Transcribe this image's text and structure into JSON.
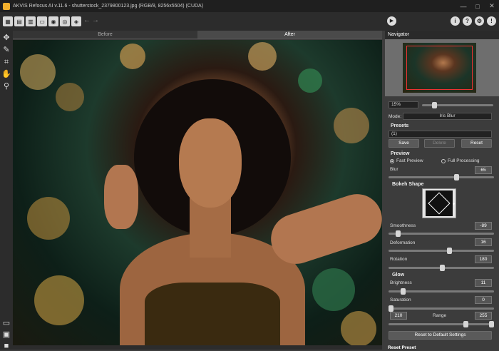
{
  "window": {
    "title": "AKVIS Refocus AI v.11.6 - shutterstock_2379800123.jpg (RGB/8, 8256x5504) (CUDA)",
    "minimize": "—",
    "maximize": "□",
    "close": "✕"
  },
  "toolbar": {
    "icons": [
      "workspace-icon",
      "open-icon",
      "save-icon",
      "print-icon",
      "share-icon",
      "batch-icon",
      "plugins-icon"
    ],
    "undo": "←",
    "redo": "→",
    "run": "▶",
    "help_about": "i",
    "help": "?",
    "settings": "⚙",
    "feedback": "!"
  },
  "tabs": {
    "before": "Before",
    "after": "After"
  },
  "tools": [
    "move-icon",
    "retouch-icon",
    "crop-icon",
    "hand-icon",
    "zoom-icon"
  ],
  "navigator": {
    "title": "Navigator",
    "zoom": "15%"
  },
  "settings": {
    "mode_label": "Mode:",
    "mode_value": "Iris Blur",
    "presets_title": "Presets",
    "preset_value": "(1)",
    "save": "Save",
    "delete": "Delete",
    "reset": "Reset",
    "preview_title": "Preview",
    "fast_preview": "Fast Preview",
    "full_processing": "Full Processing",
    "blur_label": "Blur",
    "blur": "65",
    "bokeh_title": "Bokeh Shape",
    "smoothness_label": "Smoothness",
    "smoothness": "-89",
    "deformation_label": "Deformation",
    "deformation": "16",
    "rotation_label": "Rotation",
    "rotation": "180",
    "glow_title": "Glow",
    "brightness_label": "Brightness",
    "brightness": "11",
    "saturation_label": "Saturation",
    "saturation": "0",
    "range_label": "Range",
    "range_min": "210",
    "range_max": "255",
    "reset_defaults": "Reset to Default Settings",
    "reset_preset": "Reset Preset"
  }
}
